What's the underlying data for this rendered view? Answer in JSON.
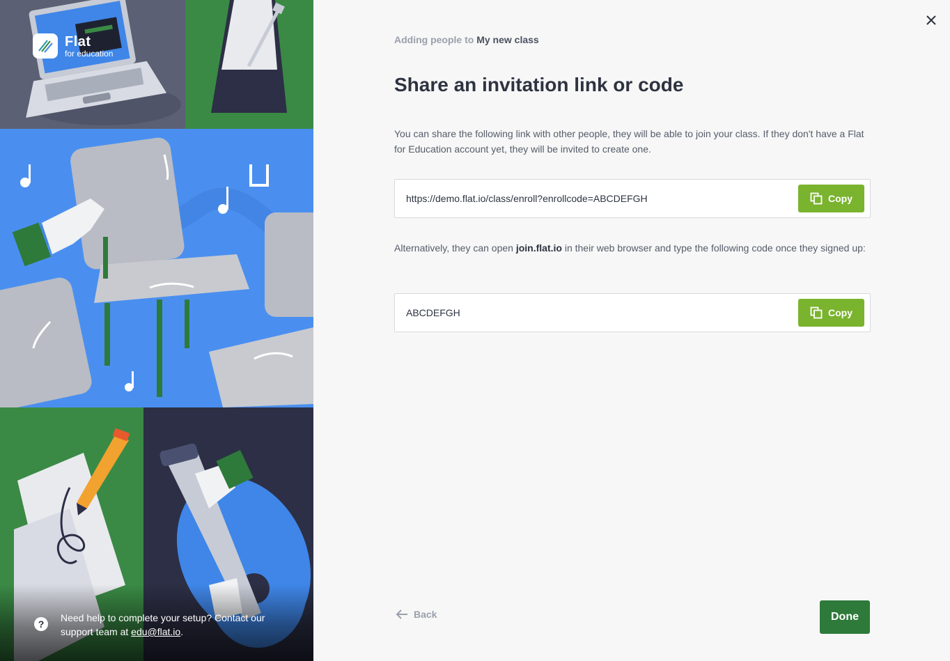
{
  "brand": {
    "name": "Flat",
    "subtitle": "for education"
  },
  "help": {
    "text_prefix": "Need help to complete your setup? Contact our support team at ",
    "email": "edu@flat.io",
    "text_suffix": "."
  },
  "header": {
    "breadcrumb_prefix": "Adding people to",
    "class_name": "My new class",
    "title": "Share an invitation link or code"
  },
  "link_section": {
    "description": "You can share the following link with other people, they will be able to join your class. If they don't have a Flat for Education account yet, they will be invited to create one.",
    "value": "https://demo.flat.io/class/enroll?enrollcode=ABCDEFGH",
    "copy_label": "Copy"
  },
  "code_section": {
    "description_prefix": "Alternatively, they can open ",
    "description_link": "join.flat.io",
    "description_suffix": " in their web browser and type the following code once they signed up:",
    "value": "ABCDEFGH",
    "copy_label": "Copy"
  },
  "footer": {
    "back_label": "Back",
    "done_label": "Done"
  },
  "colors": {
    "primary_green": "#7ab32e",
    "done_green": "#2e7a3a",
    "illustration_blue": "#4a8ff0",
    "illustration_green": "#3a8a45",
    "illustration_navy": "#2c2f45"
  },
  "icons": {
    "close": "close-icon",
    "copy": "copy-icon",
    "back": "arrow-left-icon",
    "help": "question-icon"
  }
}
